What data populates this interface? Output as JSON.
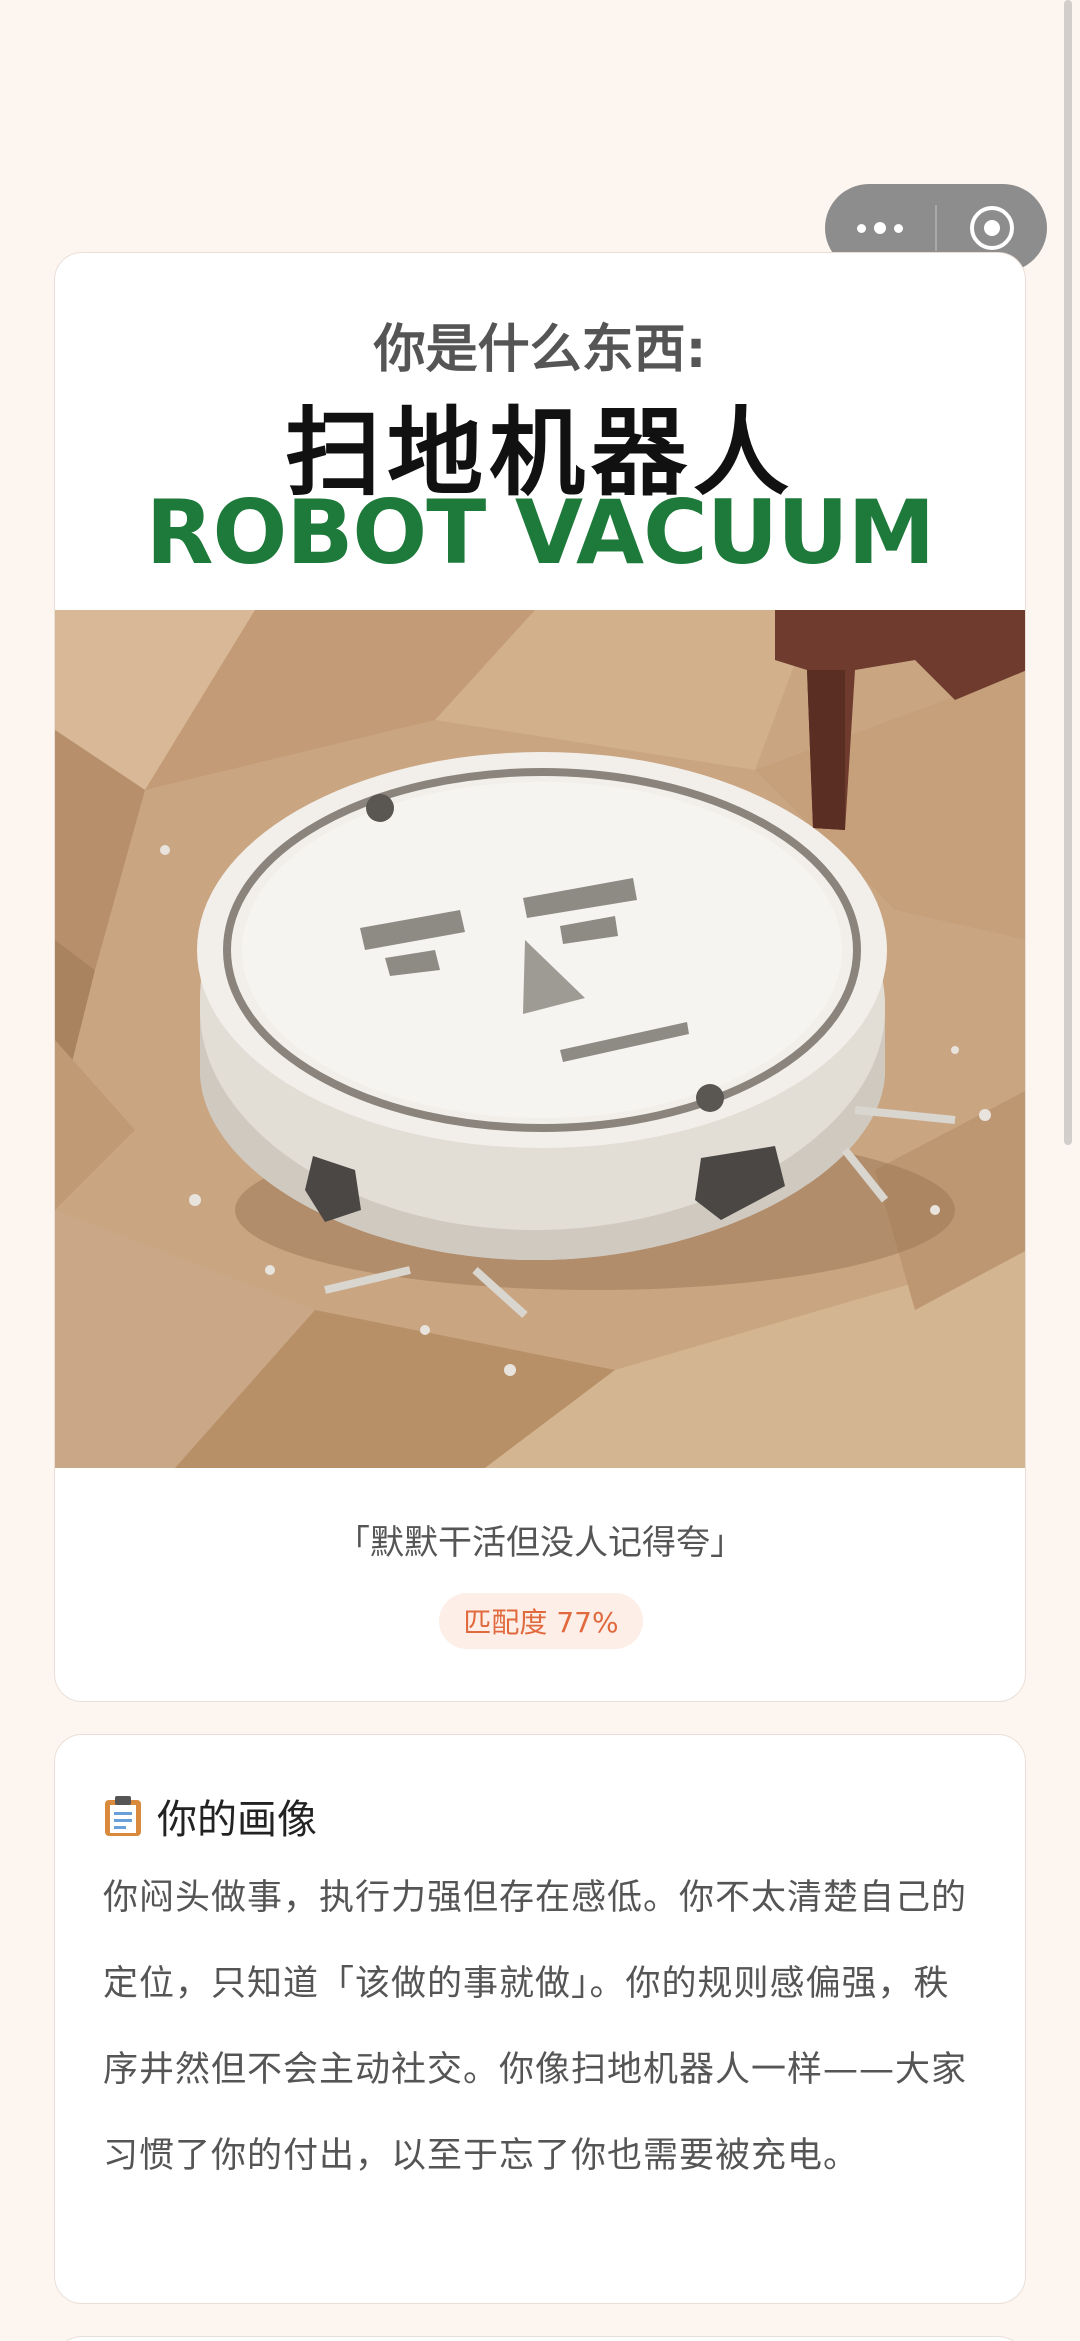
{
  "capsule": {
    "more_icon": "more-dots-icon",
    "close_icon": "target-close-icon"
  },
  "result": {
    "question": "你是什么东西:",
    "name_cn": "扫地机器人",
    "name_en": "ROBOT VACUUM",
    "quote": "「默默干活但没人记得夸」",
    "match": "匹配度 77%"
  },
  "portrait": {
    "icon": "clipboard-icon",
    "title": "你的画像",
    "body": "你闷头做事，执行力强但存在感低。你不太清楚自己的定位，只知道「该做的事就做」。你的规则感偏强，秩序井然但不会主动社交。你像扫地机器人一样——大家习惯了你的付出，以至于忘了你也需要被充电。"
  },
  "colors": {
    "accent_green": "#1d7a3a",
    "badge_text": "#e06a3e",
    "badge_bg": "#fdeee8",
    "page_bg": "#fdf5ef"
  }
}
